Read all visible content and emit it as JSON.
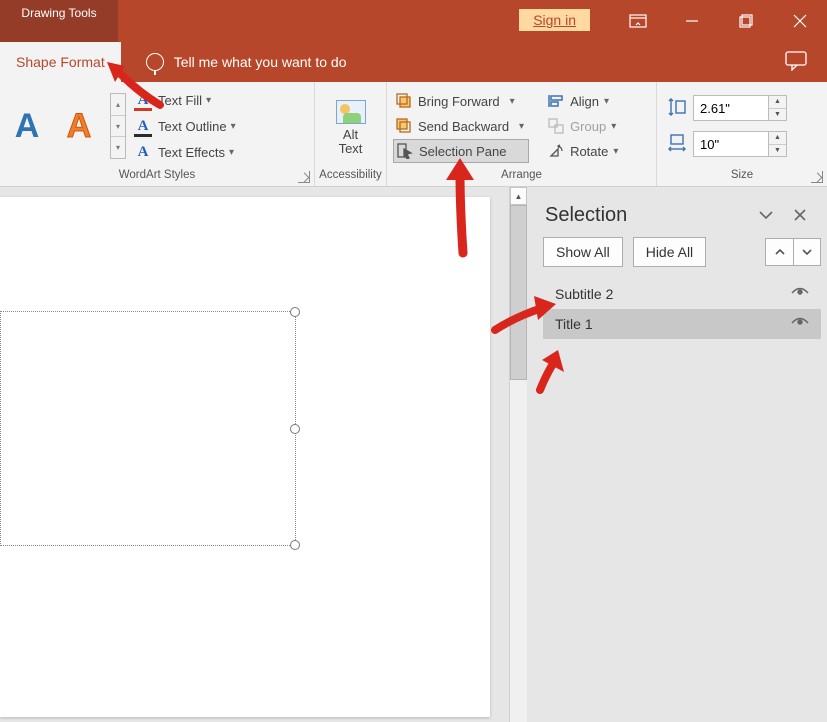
{
  "title_tab": "Drawing Tools",
  "signin": "Sign in",
  "active_tab": "Shape Format",
  "tell_me": "Tell me what you want to do",
  "ribbon": {
    "wordart": {
      "text_fill": "Text Fill",
      "text_outline": "Text Outline",
      "text_effects": "Text Effects",
      "label": "WordArt Styles"
    },
    "accessibility": {
      "alt_text": "Alt Text",
      "label": "Accessibility"
    },
    "arrange": {
      "bring_forward": "Bring Forward",
      "send_backward": "Send Backward",
      "selection_pane": "Selection Pane",
      "align": "Align",
      "group": "Group",
      "rotate": "Rotate",
      "label": "Arrange"
    },
    "size": {
      "height": "2.61\"",
      "width": "10\"",
      "label": "Size"
    }
  },
  "selection_pane": {
    "title": "Selection",
    "show_all": "Show All",
    "hide_all": "Hide All",
    "items": [
      {
        "name": "Subtitle 2",
        "selected": false
      },
      {
        "name": "Title 1",
        "selected": true
      }
    ]
  }
}
